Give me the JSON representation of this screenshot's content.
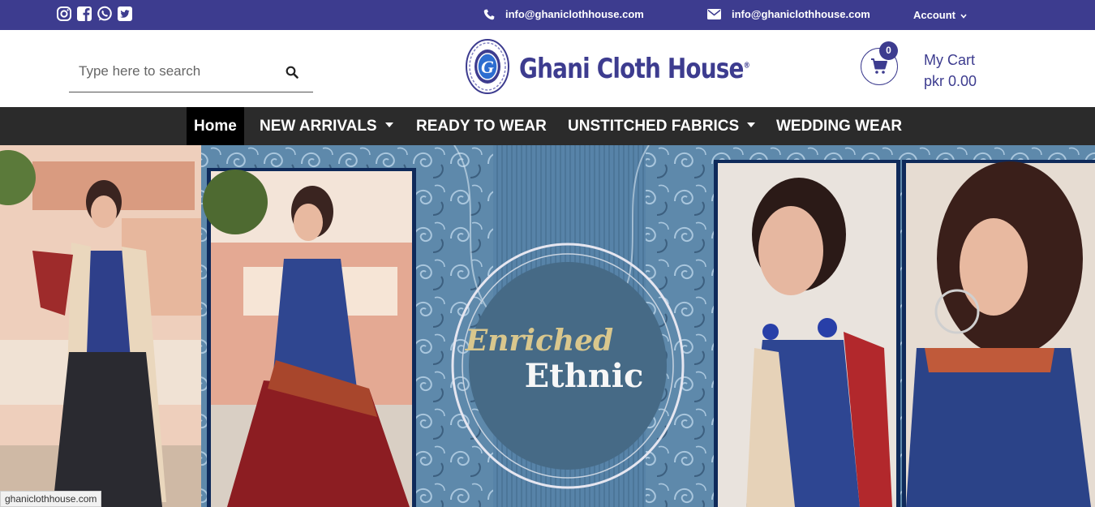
{
  "topbar": {
    "social_icons": [
      "instagram-icon",
      "facebook-icon",
      "whatsapp-icon",
      "twitter-icon"
    ],
    "phone_email": "info@ghaniclothhouse.com",
    "mail_email": "info@ghaniclothhouse.com",
    "account_label": "Account"
  },
  "header": {
    "search_placeholder": "Type here to search",
    "logo_letter": "G",
    "logo_text": "Ghani Cloth House",
    "logo_mark": "®",
    "cart_count": "0",
    "cart_label": "My Cart",
    "cart_total": "pkr 0.00"
  },
  "nav": {
    "items": [
      {
        "label": "Home",
        "active": true
      },
      {
        "label": "NEW ARRIVALS",
        "dropdown": true
      },
      {
        "label": "READY TO WEAR"
      },
      {
        "label": "UNSTITCHED FABRICS",
        "dropdown": true
      },
      {
        "label": "WEDDING WEAR"
      }
    ]
  },
  "banner": {
    "script_text": "Enriched",
    "main_text": "Ethnic"
  },
  "status_bar": {
    "url": "ghaniclothhouse.com"
  },
  "colors": {
    "brand": "#3d3c8f",
    "nav_bg": "#2b2b2b",
    "nav_active": "#000000"
  }
}
